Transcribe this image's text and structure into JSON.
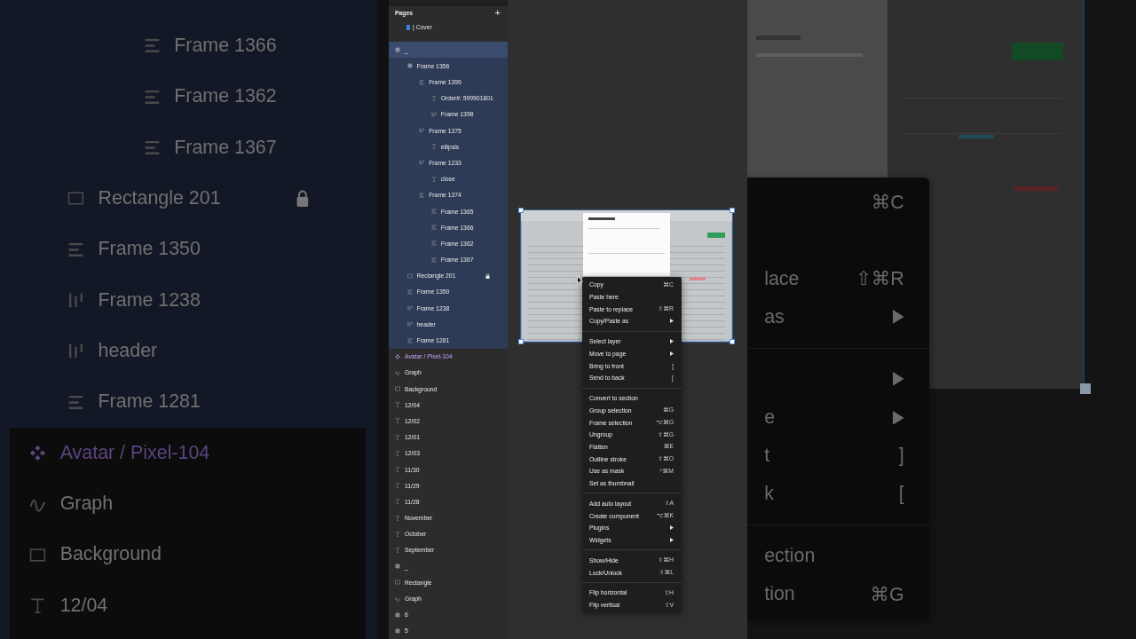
{
  "backdrop_left": {
    "layers": [
      {
        "children": [
          {
            "children": [
              {
                "children": [
                  {
                    "name": "Frame 1366",
                    "kind": "vstack",
                    "selected": true,
                    "locked": false
                  },
                  {
                    "name": "Frame 1362",
                    "kind": "vstack",
                    "selected": true,
                    "locked": false
                  },
                  {
                    "name": "Frame 1367",
                    "kind": "vstack",
                    "selected": true,
                    "locked": false
                  }
                ]
              }
            ]
          },
          {
            "name": "Rectangle 201",
            "kind": "rectangle",
            "selected": true,
            "locked": true
          },
          {
            "name": "Frame 1350",
            "kind": "vstack",
            "selected": true,
            "locked": false
          },
          {
            "name": "Frame 1238",
            "kind": "hstack",
            "selected": true,
            "locked": false
          },
          {
            "name": "header",
            "kind": "hstack",
            "selected": true,
            "locked": false
          },
          {
            "name": "Frame 1281",
            "kind": "vstack",
            "selected": true,
            "locked": false
          }
        ]
      },
      {
        "name": "Avatar / Pixel-104",
        "kind": "component",
        "selected": false,
        "locked": false
      },
      {
        "name": "Graph",
        "kind": "vector",
        "selected": false,
        "locked": false
      },
      {
        "name": "Background",
        "kind": "rectangle",
        "selected": false,
        "locked": false
      },
      {
        "name": "12/04",
        "kind": "text",
        "selected": false,
        "locked": false
      }
    ]
  },
  "layers_panel": {
    "pages_title": "Pages",
    "add_label": "+",
    "pages": [
      {
        "name": "| Cover"
      }
    ],
    "layers": [
      {
        "name": "_",
        "kind": "frame",
        "selected": true,
        "locked": false,
        "children": [
          {
            "name": "Frame 1356",
            "kind": "frame",
            "selected": true,
            "locked": false,
            "children": [
              {
                "name": "Frame 1399",
                "kind": "vstack",
                "selected": true,
                "locked": false,
                "children": [
                  {
                    "name": "Order#: 599901801",
                    "kind": "text",
                    "selected": true,
                    "locked": false
                  },
                  {
                    "name": "Frame 1398",
                    "kind": "hstack",
                    "selected": true,
                    "locked": false
                  }
                ]
              },
              {
                "name": "Frame 1375",
                "kind": "hstack",
                "selected": true,
                "locked": false,
                "children": [
                  {
                    "name": "ellipsis",
                    "kind": "text",
                    "selected": true,
                    "locked": false
                  }
                ]
              },
              {
                "name": "Frame 1233",
                "kind": "hstack",
                "selected": true,
                "locked": false,
                "children": [
                  {
                    "name": "close",
                    "kind": "text",
                    "selected": true,
                    "locked": false
                  }
                ]
              },
              {
                "name": "Frame 1374",
                "kind": "vstack",
                "selected": true,
                "locked": false,
                "children": [
                  {
                    "name": "Frame 1365",
                    "kind": "vstack",
                    "selected": true,
                    "locked": false
                  },
                  {
                    "name": "Frame 1366",
                    "kind": "vstack",
                    "selected": true,
                    "locked": false
                  },
                  {
                    "name": "Frame 1362",
                    "kind": "vstack",
                    "selected": true,
                    "locked": false
                  },
                  {
                    "name": "Frame 1367",
                    "kind": "vstack",
                    "selected": true,
                    "locked": false
                  }
                ]
              }
            ]
          },
          {
            "name": "Rectangle 201",
            "kind": "rectangle",
            "selected": true,
            "locked": true
          },
          {
            "name": "Frame 1350",
            "kind": "vstack",
            "selected": true,
            "locked": false
          },
          {
            "name": "Frame 1238",
            "kind": "hstack",
            "selected": true,
            "locked": false
          },
          {
            "name": "header",
            "kind": "hstack",
            "selected": true,
            "locked": false
          },
          {
            "name": "Frame 1281",
            "kind": "vstack",
            "selected": true,
            "locked": false
          }
        ]
      },
      {
        "name": "Avatar / Pixel-104",
        "kind": "component",
        "selected": false,
        "locked": false
      },
      {
        "name": "Graph",
        "kind": "vector",
        "selected": false,
        "locked": false
      },
      {
        "name": "Background",
        "kind": "rectangle",
        "selected": false,
        "locked": false
      },
      {
        "name": "12/04",
        "kind": "text",
        "selected": false,
        "locked": false
      },
      {
        "name": "12/02",
        "kind": "text",
        "selected": false,
        "locked": false
      },
      {
        "name": "12/01",
        "kind": "text",
        "selected": false,
        "locked": false
      },
      {
        "name": "12/03",
        "kind": "text",
        "selected": false,
        "locked": false
      },
      {
        "name": "11/30",
        "kind": "text",
        "selected": false,
        "locked": false
      },
      {
        "name": "11/29",
        "kind": "text",
        "selected": false,
        "locked": false
      },
      {
        "name": "11/28",
        "kind": "text",
        "selected": false,
        "locked": false
      },
      {
        "name": "November",
        "kind": "text",
        "selected": false,
        "locked": false
      },
      {
        "name": "October",
        "kind": "text",
        "selected": false,
        "locked": false
      },
      {
        "name": "September",
        "kind": "text",
        "selected": false,
        "locked": false
      },
      {
        "name": "_",
        "kind": "frame",
        "selected": false,
        "locked": false
      },
      {
        "name": "Rectangle",
        "kind": "rectangle",
        "selected": false,
        "locked": false
      },
      {
        "name": "Graph",
        "kind": "vector",
        "selected": false,
        "locked": false
      },
      {
        "name": "6",
        "kind": "frame",
        "selected": false,
        "locked": false
      },
      {
        "name": "5",
        "kind": "frame",
        "selected": false,
        "locked": false
      }
    ]
  },
  "context_menu": {
    "items": [
      {
        "kind": "item",
        "label": "Copy",
        "shortcut": "⌘C",
        "submenu": false
      },
      {
        "kind": "item",
        "label": "Paste here",
        "submenu": false
      },
      {
        "kind": "item",
        "label": "Paste to replace",
        "shortcut": "⇧⌘R",
        "submenu": false
      },
      {
        "kind": "item",
        "label": "Copy/Paste as",
        "submenu": true
      },
      {
        "kind": "separator"
      },
      {
        "kind": "item",
        "label": "Select layer",
        "submenu": true
      },
      {
        "kind": "item",
        "label": "Move to page",
        "submenu": true
      },
      {
        "kind": "item",
        "label": "Bring to front",
        "shortcut": "]",
        "submenu": false
      },
      {
        "kind": "item",
        "label": "Send to back",
        "shortcut": "[",
        "submenu": false
      },
      {
        "kind": "separator"
      },
      {
        "kind": "item",
        "label": "Convert to section",
        "submenu": false
      },
      {
        "kind": "item",
        "label": "Group selection",
        "shortcut": "⌘G",
        "submenu": false
      },
      {
        "kind": "item",
        "label": "Frame selection",
        "shortcut": "⌥⌘G",
        "submenu": false
      },
      {
        "kind": "item",
        "label": "Ungroup",
        "shortcut": "⇧⌘G",
        "submenu": false
      },
      {
        "kind": "item",
        "label": "Flatten",
        "shortcut": "⌘E",
        "submenu": false
      },
      {
        "kind": "item",
        "label": "Outline stroke",
        "shortcut": "⇧⌘O",
        "submenu": false
      },
      {
        "kind": "item",
        "label": "Use as mask",
        "shortcut": "^⌘M",
        "submenu": false
      },
      {
        "kind": "item",
        "label": "Set as thumbnail",
        "submenu": false
      },
      {
        "kind": "separator"
      },
      {
        "kind": "item",
        "label": "Add auto layout",
        "shortcut": "⇧A",
        "submenu": false
      },
      {
        "kind": "item",
        "label": "Create component",
        "shortcut": "⌥⌘K",
        "submenu": false
      },
      {
        "kind": "item",
        "label": "Plugins",
        "submenu": true
      },
      {
        "kind": "item",
        "label": "Widgets",
        "submenu": true
      },
      {
        "kind": "separator"
      },
      {
        "kind": "item",
        "label": "Show/Hide",
        "shortcut": "⇧⌘H",
        "submenu": false
      },
      {
        "kind": "item",
        "label": "Lock/Unlock",
        "shortcut": "⇧⌘L",
        "submenu": false
      },
      {
        "kind": "separator"
      },
      {
        "kind": "item",
        "label": "Flip horizontal",
        "shortcut": "⇧H",
        "submenu": false
      },
      {
        "kind": "item",
        "label": "Flip vertical",
        "shortcut": "⇧V",
        "submenu": false
      }
    ]
  },
  "backdrop_right": {
    "menu_items": [
      {
        "kind": "item",
        "shortcut": "⌘C",
        "submenu": false
      },
      {
        "kind": "item"
      },
      {
        "kind": "item",
        "label": "lace",
        "shortcut": "⇧⌘R",
        "submenu": false
      },
      {
        "kind": "item",
        "label": "as",
        "submenu": true
      },
      {
        "kind": "separator"
      },
      {
        "kind": "item",
        "submenu": true
      },
      {
        "kind": "item",
        "label": "e",
        "submenu": true
      },
      {
        "kind": "item",
        "label": "t",
        "shortcut": "]",
        "submenu": false
      },
      {
        "kind": "item",
        "label": "k",
        "shortcut": "[",
        "submenu": false
      },
      {
        "kind": "separator"
      },
      {
        "kind": "item",
        "label": "ection",
        "submenu": false
      },
      {
        "kind": "item",
        "label": "tion",
        "shortcut": "⌘G",
        "submenu": false
      }
    ]
  }
}
